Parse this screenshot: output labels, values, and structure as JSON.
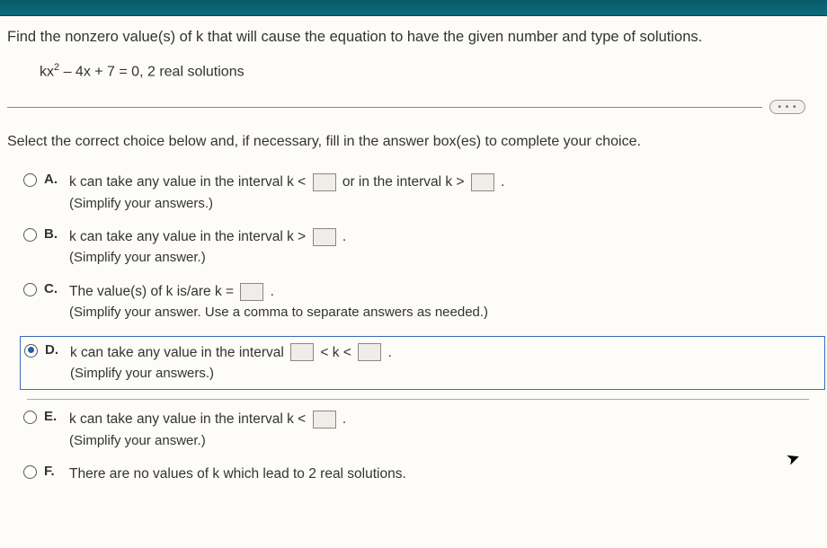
{
  "question": "Find the nonzero value(s) of k that will cause the equation to have the given number and type of solutions.",
  "equation_prefix": "kx",
  "equation_exp": "2",
  "equation_rest": " – 4x + 7 = 0, 2 real solutions",
  "ellipsis": "• • •",
  "instruction": "Select the correct choice below and, if necessary, fill in the answer box(es) to complete your choice.",
  "choices": {
    "A": {
      "label": "A.",
      "text1": "k can take any value in the interval k < ",
      "text2": " or in the interval k > ",
      "text3": " .",
      "hint": "(Simplify your answers.)"
    },
    "B": {
      "label": "B.",
      "text1": "k can take any value in the interval k > ",
      "text2": " .",
      "hint": "(Simplify your answer.)"
    },
    "C": {
      "label": "C.",
      "text1": "The value(s) of k is/are k = ",
      "text2": " .",
      "hint": "(Simplify your answer. Use a comma to separate answers as needed.)"
    },
    "D": {
      "label": "D.",
      "text1": "k can take any value in the interval ",
      "text2": " < k < ",
      "text3": " .",
      "hint": "(Simplify your answers.)"
    },
    "E": {
      "label": "E.",
      "text1": "k can take any value in the interval k < ",
      "text2": " .",
      "hint": "(Simplify your answer.)"
    },
    "F": {
      "label": "F.",
      "text": "There are no values of k which lead to 2 real solutions."
    }
  }
}
